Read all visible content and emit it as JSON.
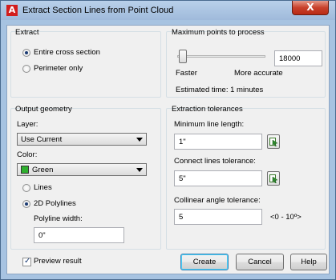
{
  "window": {
    "title": "Extract Section Lines from Point Cloud",
    "app_icon": "A",
    "close_label": "X"
  },
  "extract": {
    "title": "Extract",
    "options": [
      "Entire cross section",
      "Perimeter only"
    ],
    "selected": "Entire cross section"
  },
  "max_points": {
    "title": "Maximum points to process",
    "value": "18000",
    "slider_min_label": "Faster",
    "slider_max_label": "More accurate",
    "slider_position": 0.0,
    "estimated_time": "Estimated time: 1 minutes"
  },
  "output": {
    "title": "Output geometry",
    "layer_label": "Layer:",
    "layer_value": "Use Current",
    "color_label": "Color:",
    "color_value": "Green",
    "color_swatch": "#2fb02f",
    "geometry_options": [
      "Lines",
      "2D Polylines"
    ],
    "geometry_selected": "2D Polylines",
    "polyline_width_label": "Polyline width:",
    "polyline_width_value": "0\""
  },
  "tolerances": {
    "title": "Extraction tolerances",
    "min_length_label": "Minimum line length:",
    "min_length_value": "1\"",
    "connect_label": "Connect lines tolerance:",
    "connect_value": "5\"",
    "collinear_label": "Collinear angle tolerance:",
    "collinear_value": "5",
    "collinear_range": "<0 - 10º>"
  },
  "footer": {
    "preview_label": "Preview result",
    "preview_checked": true,
    "create_label": "Create",
    "cancel_label": "Cancel",
    "help_label": "Help"
  }
}
